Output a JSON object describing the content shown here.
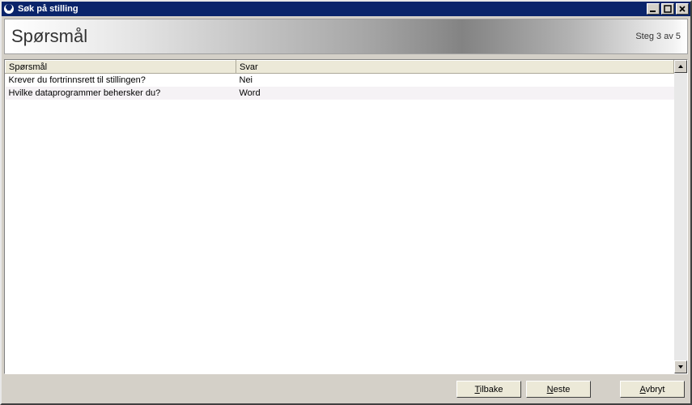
{
  "window": {
    "title": "Søk på stilling"
  },
  "header": {
    "title": "Spørsmål",
    "step": "Steg 3 av 5"
  },
  "table": {
    "columns": {
      "question": "Spørsmål",
      "answer": "Svar"
    },
    "rows": [
      {
        "question": "Krever du fortrinnsrett til stillingen?",
        "answer": "Nei"
      },
      {
        "question": "Hvilke dataprogrammer behersker du?",
        "answer": "Word"
      }
    ]
  },
  "buttons": {
    "back_prefix": "T",
    "back_rest": "ilbake",
    "next_prefix": "N",
    "next_rest": "este",
    "cancel_prefix": "A",
    "cancel_rest": "vbryt"
  }
}
